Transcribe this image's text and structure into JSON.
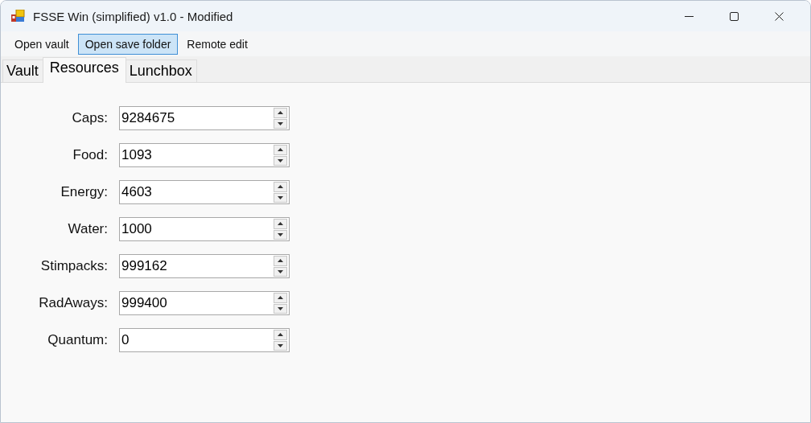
{
  "window": {
    "title": "FSSE Win (simplified) v1.0 - Modified"
  },
  "menu": [
    {
      "label": "Open vault",
      "selected": false
    },
    {
      "label": "Open save folder",
      "selected": true
    },
    {
      "label": "Remote edit",
      "selected": false
    }
  ],
  "tabs": [
    {
      "label": "Vault",
      "selected": false
    },
    {
      "label": "Resources",
      "selected": true
    },
    {
      "label": "Lunchbox",
      "selected": false
    }
  ],
  "fields": [
    {
      "label": "Caps:",
      "value": "9284675"
    },
    {
      "label": "Food:",
      "value": "1093"
    },
    {
      "label": "Energy:",
      "value": "4603"
    },
    {
      "label": "Water:",
      "value": "1000"
    },
    {
      "label": "Stimpacks:",
      "value": "999162"
    },
    {
      "label": "RadAways:",
      "value": "999400"
    },
    {
      "label": "Quantum:",
      "value": "0"
    }
  ]
}
